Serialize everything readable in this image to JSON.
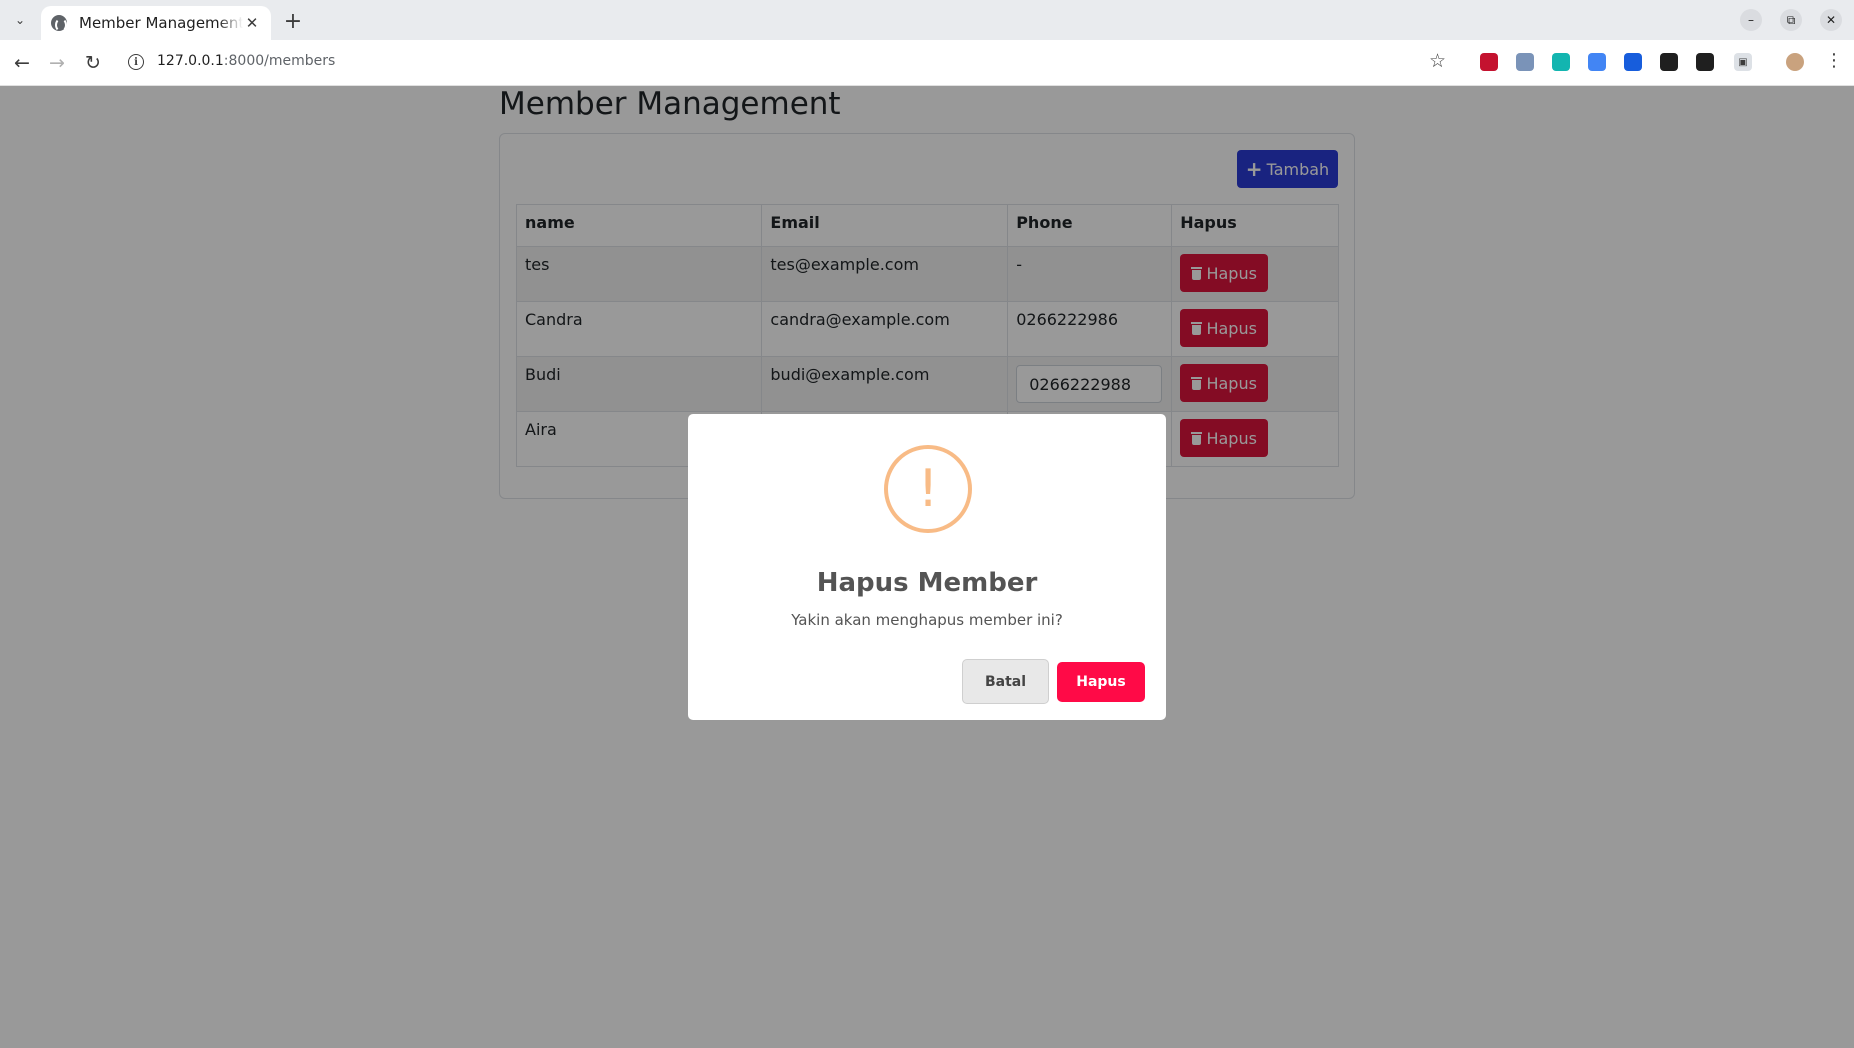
{
  "browser": {
    "tab_title": "Member Management | Laravel",
    "url_host": "127.0.0.1",
    "url_path": ":8000/members",
    "extensions": [
      {
        "name": "ublock-icon",
        "color": "#c4122f"
      },
      {
        "name": "tampermonkey-icon",
        "color": "#7a93b8"
      },
      {
        "name": "m-extension-icon",
        "color": "#13b5b0"
      },
      {
        "name": "docs-extension-icon",
        "color": "#4285f4"
      },
      {
        "name": "bitwarden-icon",
        "color": "#175ddc"
      },
      {
        "name": "notion-icon",
        "color": "#1f1f1f"
      },
      {
        "name": "zotero-icon",
        "color": "#1f1f1f"
      }
    ]
  },
  "page": {
    "title": "Member Management",
    "add_button_label": "Tambah",
    "table": {
      "headers": [
        "name",
        "Email",
        "Phone",
        "Hapus"
      ],
      "rows": [
        {
          "name": "tes",
          "email": "tes@example.com",
          "phone": "-",
          "action": "Hapus"
        },
        {
          "name": "Candra",
          "email": "candra@example.com",
          "phone": "0266222986",
          "action": "Hapus"
        },
        {
          "name": "Budi",
          "email": "budi@example.com",
          "phone": "0266222988",
          "action": "Hapus"
        },
        {
          "name": "Aira",
          "email": "",
          "phone": "",
          "action": "Hapus"
        }
      ]
    }
  },
  "modal": {
    "icon": "!",
    "title": "Hapus Member",
    "text": "Yakin akan menghapus member ini?",
    "cancel_label": "Batal",
    "confirm_label": "Hapus",
    "colors": {
      "confirm": "#ff0a47",
      "warning": "#f8bb86"
    }
  }
}
